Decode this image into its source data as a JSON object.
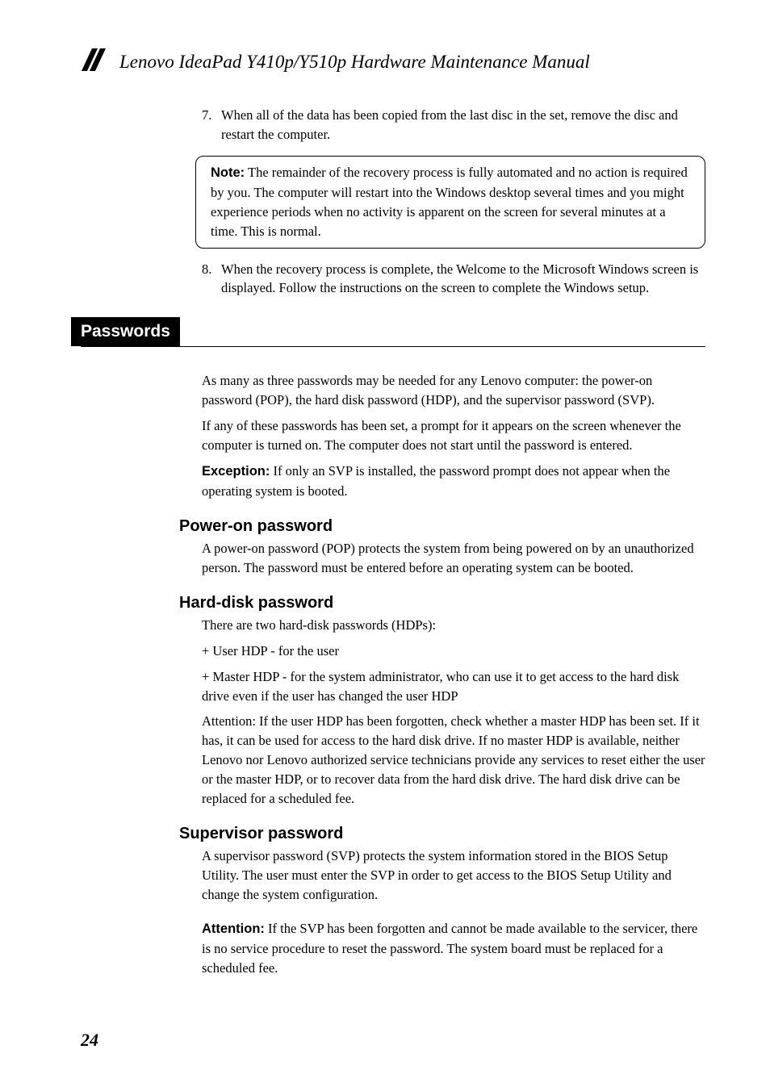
{
  "header": {
    "title": "Lenovo IdeaPad Y410p/Y510p Hardware Maintenance Manual"
  },
  "list1": {
    "item7_num": "7.",
    "item7": "When all of the data has been copied from the last disc in the set, remove the disc and restart the computer.",
    "item8_num": "8.",
    "item8": "When the recovery process is complete, the Welcome to the Microsoft Windows screen is displayed. Follow the instructions on the screen to complete the Windows setup."
  },
  "note": {
    "label": "Note:",
    "text": " The remainder of the recovery process is fully automated and no action is required by you. The computer will restart into the Windows desktop several times and you might experience periods when no activity is apparent on the screen for several minutes at a time. This is normal."
  },
  "section": {
    "title": "Passwords",
    "intro1": "As many as three passwords may be needed for any Lenovo computer: the power-on password (POP), the hard disk password (HDP), and the supervisor password (SVP).",
    "intro2": "If any of these passwords has been set, a prompt for it appears on the screen whenever the computer is turned on. The computer does not start until the password is entered.",
    "exception_label": "Exception:",
    "exception_text": " If only an SVP is installed, the password prompt does not appear when the operating system is booted."
  },
  "pop": {
    "heading": "Power-on password",
    "text": "A power-on password (POP) protects the system from being powered on by an unauthorized person. The password must be entered before an operating system can be booted."
  },
  "hdp": {
    "heading": "Hard-disk password",
    "intro": "There are two hard-disk passwords (HDPs):",
    "user": "+ User HDP - for the user",
    "master": "+ Master HDP - for the system administrator, who can use it to get access to the hard disk drive even if the user has changed the user HDP",
    "attention": "Attention: If the user HDP has been forgotten, check whether a master HDP has been set. If it has, it can be used for access to the hard disk drive. If no master HDP is available, neither Lenovo nor Lenovo authorized service technicians provide any services to reset either the user or the master HDP, or to recover data from the hard disk drive. The hard disk drive can be replaced for a scheduled fee."
  },
  "svp": {
    "heading": "Supervisor password",
    "text": "A supervisor password (SVP) protects the system information stored in the BIOS Setup Utility. The user must enter the SVP in order to get access to the BIOS Setup Utility and change the system configuration.",
    "attention_label": "Attention:",
    "attention_text": " If the SVP has been forgotten and cannot be made available to the servicer, there is no service procedure to reset the password. The system board must be replaced for a scheduled fee."
  },
  "page_number": "24"
}
